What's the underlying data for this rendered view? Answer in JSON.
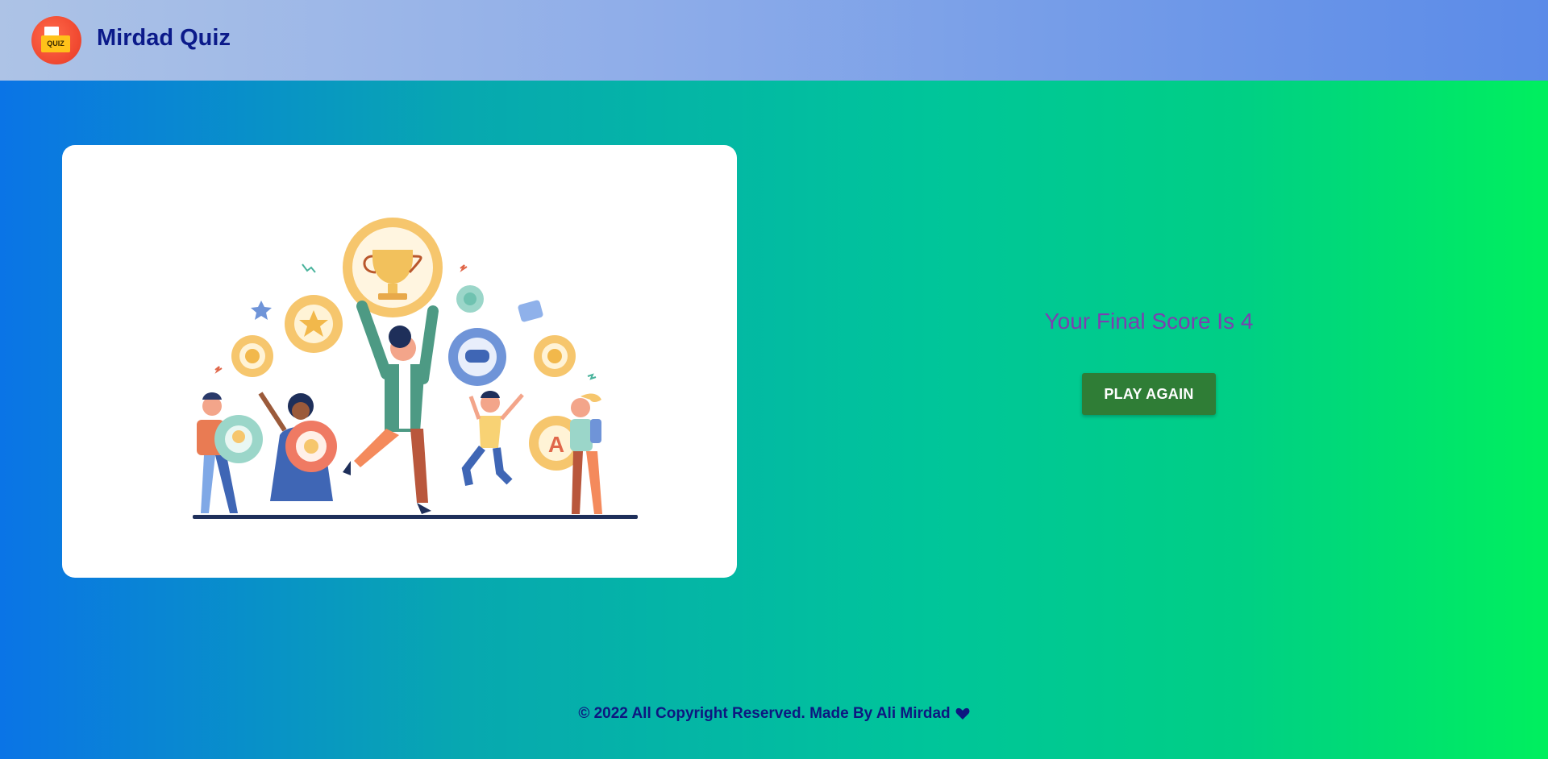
{
  "header": {
    "logo_label": "QUIZ",
    "title": "Mirdad Quiz"
  },
  "illustration": {
    "alt": "celebrating people with trophy illustration",
    "letter": "A"
  },
  "result": {
    "score_text": "Your Final Score Is 4",
    "play_again_label": "PLAY AGAIN"
  },
  "footer": {
    "text": "© 2022 All Copyright Reserved. Made By Ali Mirdad",
    "icon": "heart-icon"
  },
  "colors": {
    "header_title": "#0b1a8a",
    "score_text": "#7d3eb0",
    "button_bg": "#2f7d36",
    "footer_text": "#0d1780"
  }
}
